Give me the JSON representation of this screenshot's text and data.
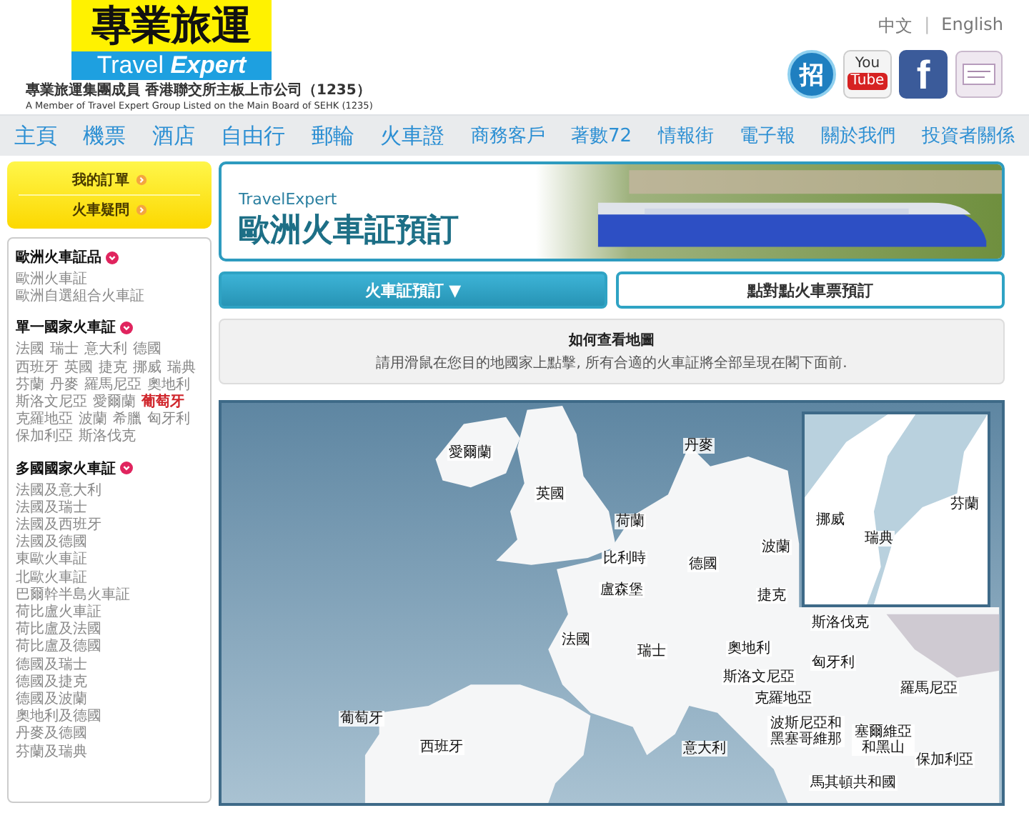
{
  "header": {
    "logo": {
      "chinese": "專業旅運",
      "english_1": "Travel",
      "english_2": "Expert"
    },
    "tagline_zh": "專業旅運集團成員 香港聯交所主板上市公司（1235）",
    "tagline_en": "A Member of Travel Expert Group   Listed on the Main Board of SEHK (1235)",
    "languages": [
      "中文",
      "English"
    ],
    "separator": "|",
    "social": [
      {
        "kind": "recruit",
        "label": "招"
      },
      {
        "kind": "youtube",
        "label": "You",
        "label_2": "Tube"
      },
      {
        "kind": "facebook",
        "label": "f"
      },
      {
        "kind": "certificate"
      }
    ]
  },
  "nav": [
    "主頁",
    "機票",
    "酒店",
    "自由行",
    "郵輪",
    "火車證",
    "商務客戶",
    "著數72",
    "情報街",
    "電子報",
    "關於我們",
    "投資者關係"
  ],
  "sidebar": {
    "quick_links": [
      "我的訂單",
      "火車疑問"
    ],
    "sections": [
      {
        "title": "歐洲火車証品",
        "kind": "list",
        "items": [
          {
            "label": "歐洲火車証",
            "selected": false
          },
          {
            "label": "歐洲自選組合火車証",
            "selected": false
          }
        ]
      },
      {
        "title": "單一國家火車証",
        "kind": "inline",
        "items": [
          {
            "label": "法國",
            "selected": false
          },
          {
            "label": "瑞士",
            "selected": false
          },
          {
            "label": "意大利",
            "selected": false
          },
          {
            "label": "德國",
            "selected": false
          },
          {
            "label": "西班牙",
            "selected": false
          },
          {
            "label": "英國",
            "selected": false
          },
          {
            "label": "捷克",
            "selected": false
          },
          {
            "label": "挪威",
            "selected": false
          },
          {
            "label": "瑞典",
            "selected": false
          },
          {
            "label": "芬蘭",
            "selected": false
          },
          {
            "label": "丹麥",
            "selected": false
          },
          {
            "label": "羅馬尼亞",
            "selected": false
          },
          {
            "label": "奧地利",
            "selected": false
          },
          {
            "label": "斯洛文尼亞",
            "selected": false
          },
          {
            "label": "愛爾蘭",
            "selected": false
          },
          {
            "label": "葡萄牙",
            "selected": true
          },
          {
            "label": "克羅地亞",
            "selected": false
          },
          {
            "label": "波蘭",
            "selected": false
          },
          {
            "label": "希臘",
            "selected": false
          },
          {
            "label": "匈牙利",
            "selected": false
          },
          {
            "label": "保加利亞",
            "selected": false
          },
          {
            "label": "斯洛伐克",
            "selected": false
          }
        ]
      },
      {
        "title": "多國國家火車証",
        "kind": "list",
        "items": [
          {
            "label": "法國及意大利",
            "selected": false
          },
          {
            "label": "法國及瑞士",
            "selected": false
          },
          {
            "label": "法國及西班牙",
            "selected": false
          },
          {
            "label": "法國及德國",
            "selected": false
          },
          {
            "label": "東歐火車証",
            "selected": false
          },
          {
            "label": "北歐火車証",
            "selected": false
          },
          {
            "label": "巴爾幹半島火車証",
            "selected": false
          },
          {
            "label": "荷比盧火車証",
            "selected": false
          },
          {
            "label": "荷比盧及法國",
            "selected": false
          },
          {
            "label": "荷比盧及德國",
            "selected": false
          },
          {
            "label": "德國及瑞士",
            "selected": false
          },
          {
            "label": "德國及捷克",
            "selected": false
          },
          {
            "label": "德國及波蘭",
            "selected": false
          },
          {
            "label": "奧地利及德國",
            "selected": false
          },
          {
            "label": "丹麥及德國",
            "selected": false
          },
          {
            "label": "芬蘭及瑞典",
            "selected": false
          }
        ]
      }
    ]
  },
  "banner": {
    "brand": "TravelExpert",
    "title": "歐洲火車証預訂"
  },
  "tabs": [
    {
      "label": "火車証預訂 ▼",
      "selected": true
    },
    {
      "label": "點對點火車票預訂",
      "selected": false
    }
  ],
  "info": {
    "title": "如何查看地圖",
    "text": "請用滑鼠在您目的地國家上點擊, 所有合適的火車証將全部呈現在閣下面前."
  },
  "map": {
    "labels": [
      "愛爾蘭",
      "丹麥",
      "英國",
      "荷蘭",
      "比利時",
      "德國",
      "波蘭",
      "盧森堡",
      "捷克",
      "斯洛伐克",
      "法國",
      "瑞士",
      "奧地利",
      "匈牙利",
      "斯洛文尼亞",
      "克羅地亞",
      "羅馬尼亞",
      "葡萄牙",
      "西班牙",
      "意大利",
      "波斯尼亞和黑塞哥維那",
      "塞爾維亞和黑山",
      "保加利亞",
      "馬其頓共和國"
    ],
    "inset_labels": [
      "挪威",
      "瑞典",
      "芬蘭"
    ]
  }
}
